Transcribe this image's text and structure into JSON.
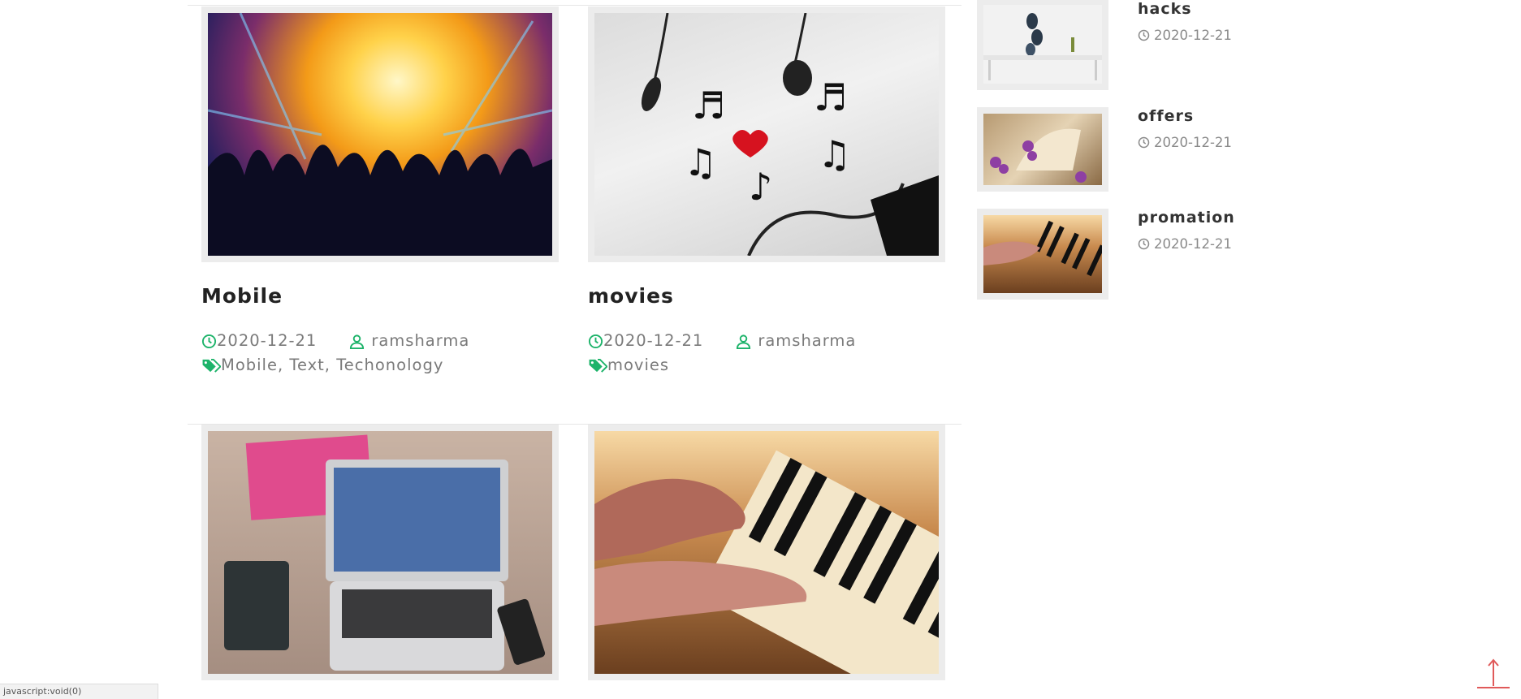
{
  "posts": [
    {
      "title": "Mobile",
      "date": "2020-12-21",
      "author": "ramsharma",
      "tags": "Mobile, Text, Techonology",
      "image": "concert-crowd-image"
    },
    {
      "title": "movies",
      "date": "2020-12-21",
      "author": "ramsharma",
      "tags": "movies",
      "image": "earphones-music-notes-image"
    },
    {
      "image": "laptop-desk-image"
    },
    {
      "image": "piano-hands-image"
    }
  ],
  "sidebar": {
    "items": [
      {
        "title": "hacks",
        "date": "2020-12-21",
        "image": "shelf-decor-image"
      },
      {
        "title": "offers",
        "date": "2020-12-21",
        "image": "book-flowers-image"
      },
      {
        "title": "promation",
        "date": "2020-12-21",
        "image": "piano-hands-image"
      }
    ]
  },
  "status_bar": {
    "text": "javascript:void(0)"
  },
  "colors": {
    "accent_icon": "#1db36a",
    "scroll_top": "#e05a5a"
  },
  "icons": [
    "clock-icon",
    "user-icon",
    "tag-icon",
    "arrow-up-icon"
  ]
}
